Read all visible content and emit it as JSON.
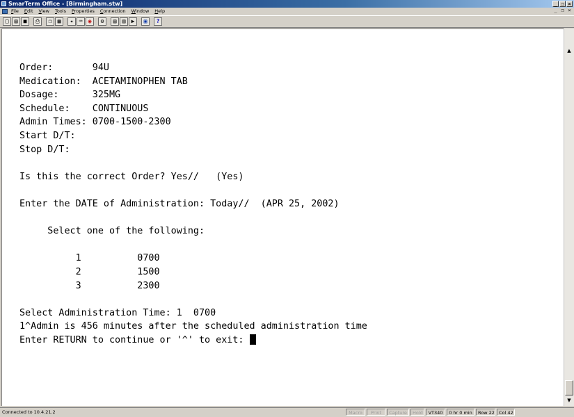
{
  "window": {
    "title": "SmarTerm Office - [Birmingham.stw]",
    "buttons": [
      "_",
      "❐",
      "×"
    ]
  },
  "menubar": {
    "items": [
      "File",
      "Edit",
      "View",
      "Tools",
      "Properties",
      "Connection",
      "Window",
      "Help"
    ],
    "mdi_buttons": [
      "_",
      "❐",
      "×"
    ]
  },
  "toolbar": {
    "buttons": [
      {
        "icon": "new-document-icon",
        "glyph": "□"
      },
      {
        "icon": "open-folder-icon",
        "glyph": "▤"
      },
      {
        "icon": "save-disk-icon",
        "glyph": "■"
      },
      {
        "icon": "printer-icon",
        "glyph": "⎙"
      },
      {
        "icon": "copy-icon",
        "glyph": "❐"
      },
      {
        "icon": "paste-icon",
        "glyph": "▦"
      },
      {
        "icon": "macro-icon",
        "glyph": "✦"
      },
      {
        "icon": "keyboard-icon",
        "glyph": "⌨"
      },
      {
        "icon": "record-icon",
        "glyph": "◉"
      },
      {
        "icon": "settings-icon",
        "glyph": "⚙"
      },
      {
        "icon": "page-icon",
        "glyph": "▤"
      },
      {
        "icon": "page-list-icon",
        "glyph": "▥"
      },
      {
        "icon": "pointer-icon",
        "glyph": "▶"
      },
      {
        "icon": "screen-icon",
        "glyph": "▣"
      },
      {
        "icon": "help-icon",
        "glyph": "?"
      }
    ]
  },
  "terminal": {
    "lines": [
      "Order:       94U",
      "Medication:  ACETAMINOPHEN TAB",
      "Dosage:      325MG",
      "Schedule:    CONTINUOUS",
      "Admin Times: 0700-1500-2300",
      "Start D/T:",
      "Stop D/T:",
      "",
      "Is this the correct Order? Yes//   (Yes)",
      "",
      "Enter the DATE of Administration: Today//  (APR 25, 2002)",
      "",
      "     Select one of the following:",
      "",
      "          1          0700",
      "          2          1500",
      "          3          2300",
      "",
      "Select Administration Time: 1  0700",
      "1^Admin is 456 minutes after the scheduled administration time"
    ],
    "prompt": "Enter RETURN to continue or '^' to exit: "
  },
  "scrollbar": {
    "up": "▲",
    "down": "▼"
  },
  "statusbar": {
    "connection": "Connected to 10.4.21.2",
    "panels": [
      "Macro",
      "Print",
      "Capture",
      "Hold",
      "VT340",
      "0 hr 0 min",
      "Row 22",
      "Col 42"
    ]
  }
}
